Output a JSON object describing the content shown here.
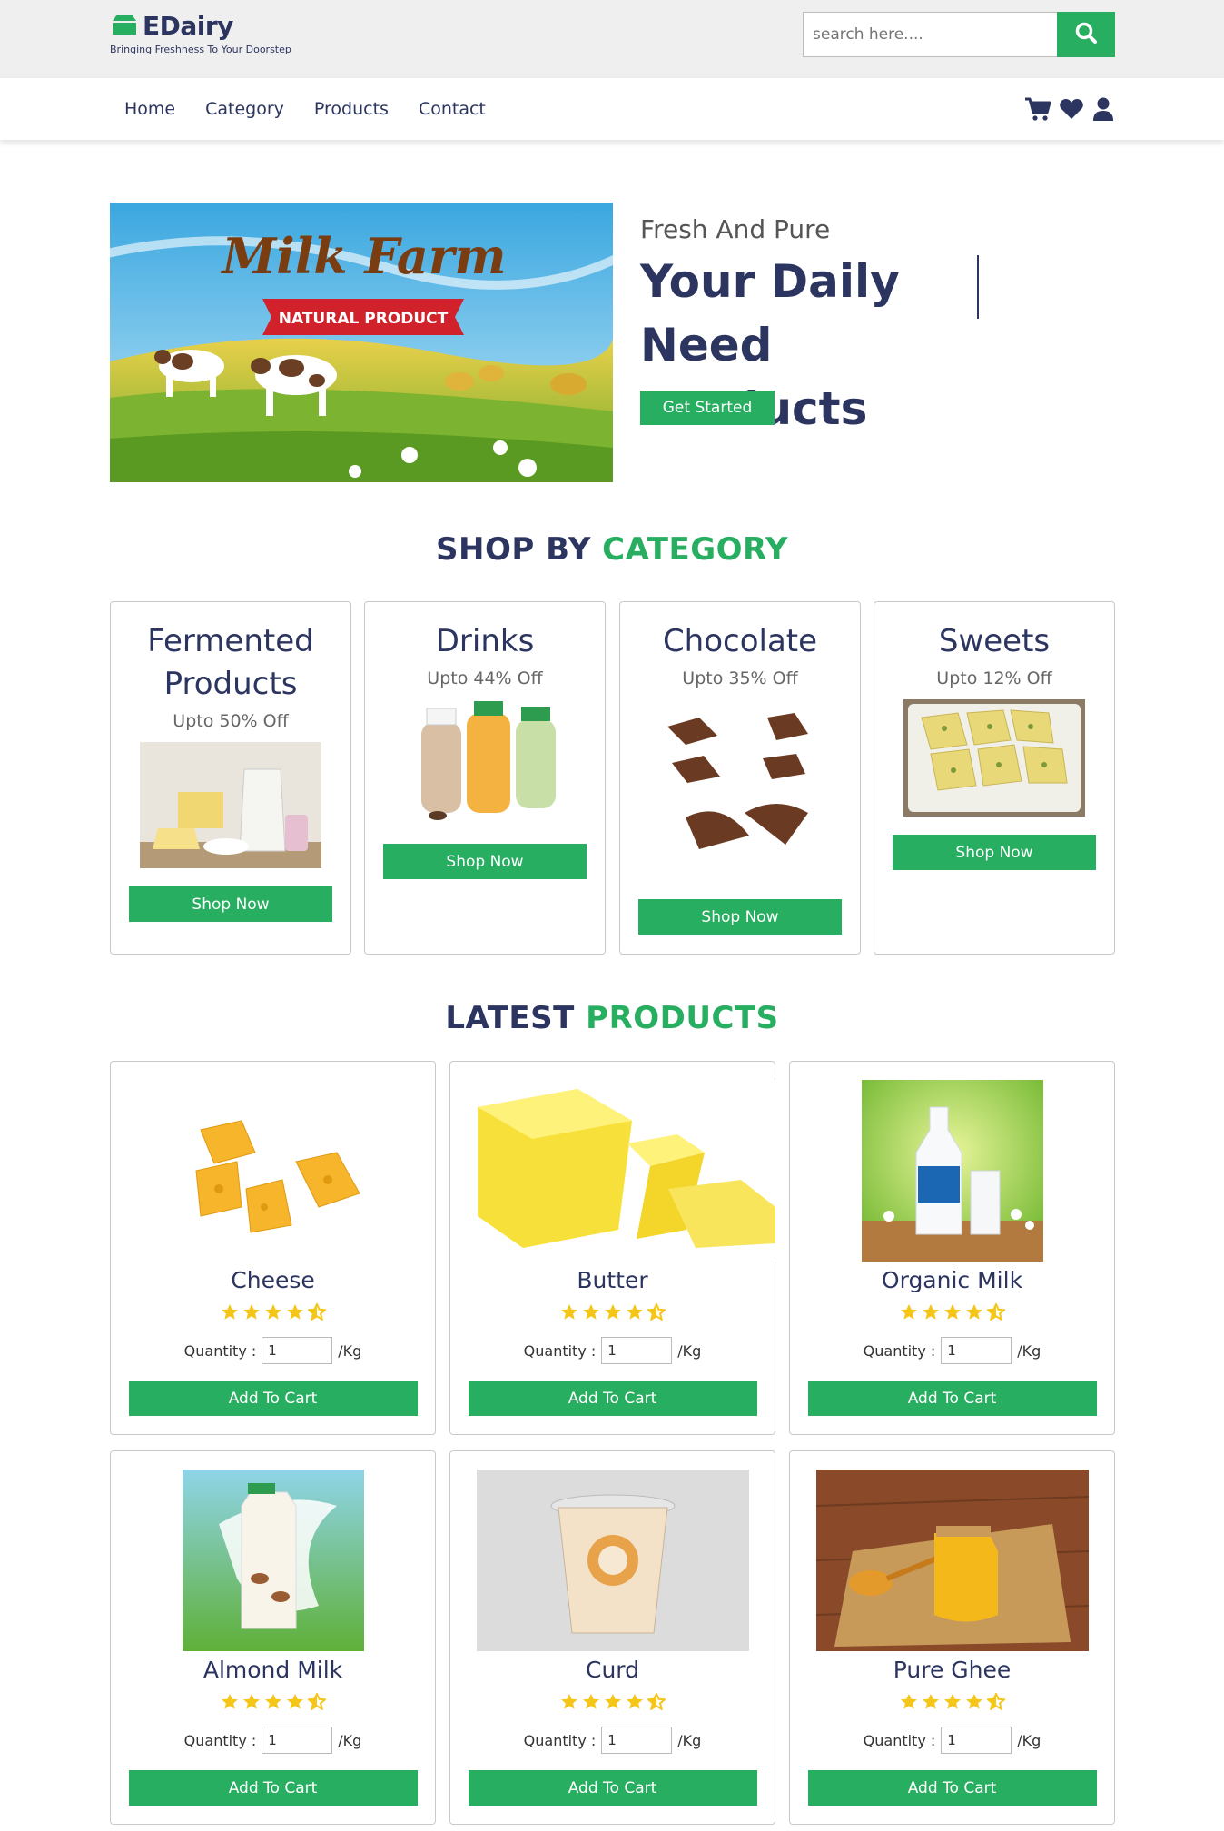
{
  "brand": {
    "name": "EDairy",
    "tagline": "Bringing Freshness To Your Doorstep"
  },
  "search": {
    "placeholder": "search here...."
  },
  "nav": {
    "links": [
      "Home",
      "Category",
      "Products",
      "Contact"
    ]
  },
  "hero": {
    "image_text": "Milk Farm",
    "image_banner": "NATURAL PRODUCT",
    "subtitle": "Fresh And Pure",
    "title": "Your Daily Need Products",
    "button": "Get Started"
  },
  "category_section": {
    "title_a": "SHOP BY",
    "title_b": "CATEGORY"
  },
  "categories": [
    {
      "name": "Fermented Products",
      "offer": "Upto 50% Off",
      "button": "Shop Now"
    },
    {
      "name": "Drinks",
      "offer": "Upto 44% Off",
      "button": "Shop Now"
    },
    {
      "name": "Chocolate",
      "offer": "Upto 35% Off",
      "button": "Shop Now"
    },
    {
      "name": "Sweets",
      "offer": "Upto 12% Off",
      "button": "Shop Now"
    }
  ],
  "products_section": {
    "title_a": "LATEST",
    "title_b": "PRODUCTS"
  },
  "products": [
    {
      "name": "Cheese",
      "rating": 4.5,
      "qty_label": "Quantity :",
      "qty": "1",
      "unit": "/Kg",
      "button": "Add To Cart"
    },
    {
      "name": "Butter",
      "rating": 4.5,
      "qty_label": "Quantity :",
      "qty": "1",
      "unit": "/Kg",
      "button": "Add To Cart"
    },
    {
      "name": "Organic Milk",
      "rating": 4.5,
      "qty_label": "Quantity :",
      "qty": "1",
      "unit": "/Kg",
      "button": "Add To Cart"
    },
    {
      "name": "Almond Milk",
      "rating": 4.5,
      "qty_label": "Quantity :",
      "qty": "1",
      "unit": "/Kg",
      "button": "Add To Cart"
    },
    {
      "name": "Curd",
      "rating": 4.5,
      "qty_label": "Quantity :",
      "qty": "1",
      "unit": "/Kg",
      "button": "Add To Cart"
    },
    {
      "name": "Pure Ghee",
      "rating": 4.5,
      "qty_label": "Quantity :",
      "qty": "1",
      "unit": "/Kg",
      "button": "Add To Cart"
    }
  ],
  "icons": [
    "shop-logo-icon",
    "search-icon",
    "cart-icon",
    "heart-icon",
    "user-icon",
    "star-icon",
    "half-star-icon"
  ],
  "colors": {
    "primary": "#27ae60",
    "navy": "#2c3560",
    "star": "#f5c518",
    "topbar": "#efefef"
  }
}
